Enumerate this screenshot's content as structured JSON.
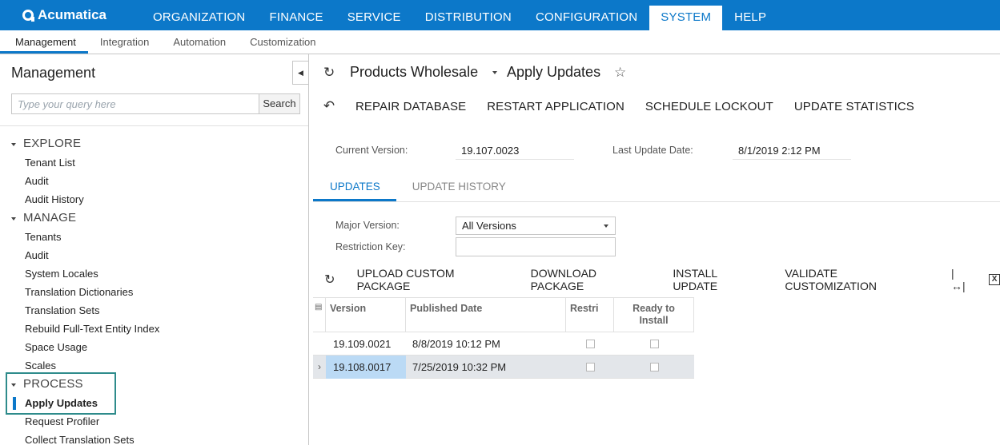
{
  "app": {
    "logo_text": "Acumatica",
    "brand_color": "#0c78c9"
  },
  "topnav": [
    "ORGANIZATION",
    "FINANCE",
    "SERVICE",
    "DISTRIBUTION",
    "CONFIGURATION",
    "SYSTEM",
    "HELP"
  ],
  "topnav_active": "SYSTEM",
  "subnav": [
    "Management",
    "Integration",
    "Automation",
    "Customization"
  ],
  "sidebar": {
    "title": "Management",
    "search_placeholder": "Type your query here",
    "search_button": "Search",
    "groups": [
      {
        "label": "EXPLORE",
        "items": [
          "Tenant List",
          "Audit",
          "Audit History"
        ]
      },
      {
        "label": "MANAGE",
        "items": [
          "Tenants",
          "Audit",
          "System Locales",
          "Translation Dictionaries",
          "Translation Sets",
          "Rebuild Full-Text Entity Index",
          "Space Usage",
          "Scales"
        ]
      },
      {
        "label": "PROCESS",
        "items": [
          "Apply Updates",
          "Request Profiler",
          "Collect Translation Sets"
        ]
      }
    ]
  },
  "main": {
    "company": "Products Wholesale",
    "screen_title": "Apply Updates",
    "toolbar": [
      "REPAIR DATABASE",
      "RESTART APPLICATION",
      "SCHEDULE LOCKOUT",
      "UPDATE STATISTICS"
    ],
    "current_version_label": "Current Version:",
    "current_version": "19.107.0023",
    "last_update_label": "Last Update Date:",
    "last_update": "8/1/2019 2:12 PM",
    "tabs": [
      "UPDATES",
      "UPDATE HISTORY"
    ],
    "major_version_label": "Major Version:",
    "major_version": "All Versions",
    "restriction_key_label": "Restriction Key:",
    "restriction_key": "",
    "grid_toolbar": [
      "UPLOAD CUSTOM PACKAGE",
      "DOWNLOAD PACKAGE",
      "INSTALL UPDATE",
      "VALIDATE CUSTOMIZATION"
    ],
    "grid": {
      "headers": [
        "Version",
        "Published Date",
        "Restri",
        "Ready to Install"
      ],
      "rows": [
        {
          "version": "19.109.0021",
          "published": "8/8/2019 10:12 PM",
          "restricted": false,
          "ready": false
        },
        {
          "version": "19.108.0017",
          "published": "7/25/2019 10:32 PM",
          "restricted": false,
          "ready": false
        }
      ]
    }
  }
}
